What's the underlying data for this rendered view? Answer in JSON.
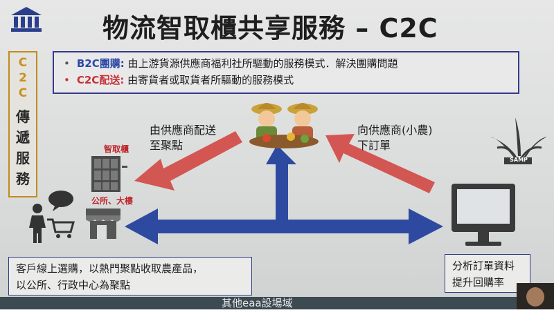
{
  "title": "物流智取櫃共享服務 – C2C",
  "info": {
    "b2c_label": "B2C團購:",
    "b2c_text": " 由上游貨源供應商福利社所驅動的服務模式．解決團購問題",
    "c2c_label": "C2C配送:",
    "c2c_text": " 由寄貨者或取貨者所驅動的服務模式"
  },
  "side": {
    "top": "C2C",
    "bottom": "傳遞服務"
  },
  "supplier_send": "由供應商配送\n至聚點",
  "order_supplier": "向供應商(小農)\n下訂單",
  "locker_label": "智取櫃",
  "office_label": "公所、大樓",
  "logo_text": "SAMP",
  "bottom_left": "客戶線上選購，以熱門聚點收取農產品，\n以公所、行政中心為聚點",
  "bottom_right": "分析訂單資料\n提升回購率",
  "footer": "其他eaa設場域"
}
